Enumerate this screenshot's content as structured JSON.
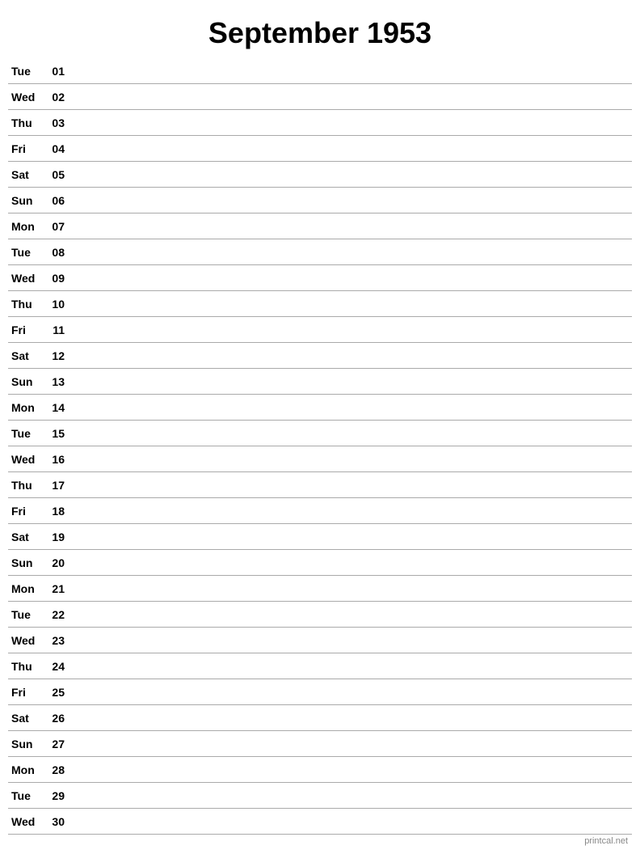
{
  "title": "September 1953",
  "watermark": "printcal.net",
  "days": [
    {
      "name": "Tue",
      "number": "01"
    },
    {
      "name": "Wed",
      "number": "02"
    },
    {
      "name": "Thu",
      "number": "03"
    },
    {
      "name": "Fri",
      "number": "04"
    },
    {
      "name": "Sat",
      "number": "05"
    },
    {
      "name": "Sun",
      "number": "06"
    },
    {
      "name": "Mon",
      "number": "07"
    },
    {
      "name": "Tue",
      "number": "08"
    },
    {
      "name": "Wed",
      "number": "09"
    },
    {
      "name": "Thu",
      "number": "10"
    },
    {
      "name": "Fri",
      "number": "11"
    },
    {
      "name": "Sat",
      "number": "12"
    },
    {
      "name": "Sun",
      "number": "13"
    },
    {
      "name": "Mon",
      "number": "14"
    },
    {
      "name": "Tue",
      "number": "15"
    },
    {
      "name": "Wed",
      "number": "16"
    },
    {
      "name": "Thu",
      "number": "17"
    },
    {
      "name": "Fri",
      "number": "18"
    },
    {
      "name": "Sat",
      "number": "19"
    },
    {
      "name": "Sun",
      "number": "20"
    },
    {
      "name": "Mon",
      "number": "21"
    },
    {
      "name": "Tue",
      "number": "22"
    },
    {
      "name": "Wed",
      "number": "23"
    },
    {
      "name": "Thu",
      "number": "24"
    },
    {
      "name": "Fri",
      "number": "25"
    },
    {
      "name": "Sat",
      "number": "26"
    },
    {
      "name": "Sun",
      "number": "27"
    },
    {
      "name": "Mon",
      "number": "28"
    },
    {
      "name": "Tue",
      "number": "29"
    },
    {
      "name": "Wed",
      "number": "30"
    }
  ]
}
